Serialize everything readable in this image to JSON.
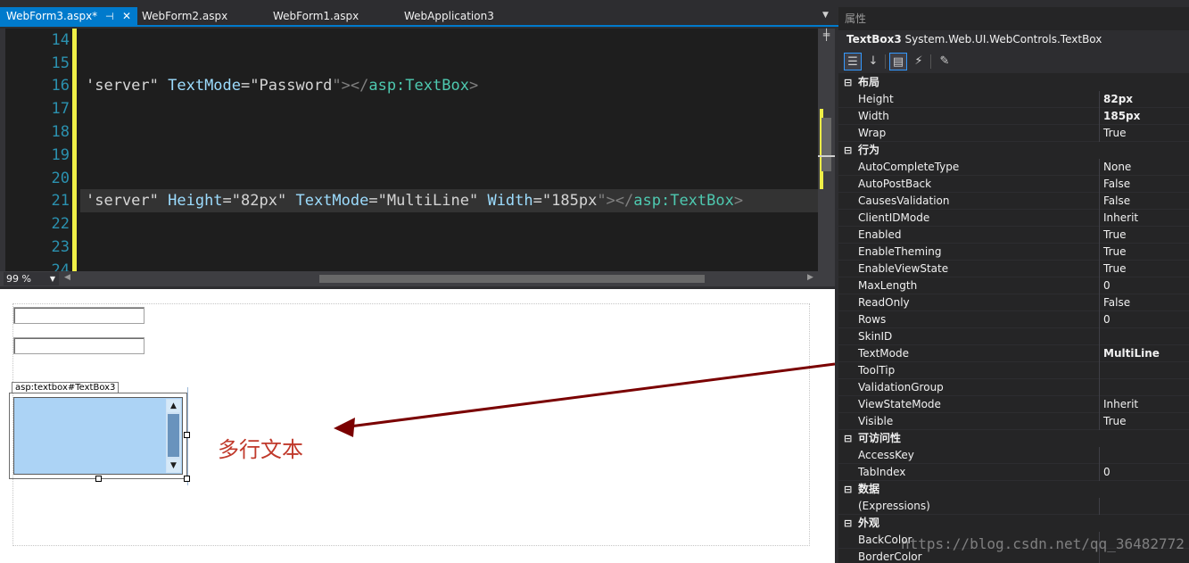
{
  "tabs": [
    {
      "label": "WebForm3.aspx*",
      "active": true
    },
    {
      "label": "WebForm2.aspx",
      "active": false
    },
    {
      "label": "WebForm1.aspx",
      "active": false
    },
    {
      "label": "WebApplication3",
      "active": false
    }
  ],
  "editor": {
    "line_numbers": [
      "14",
      "15",
      "16",
      "17",
      "18",
      "19",
      "20",
      "21",
      "22",
      "23",
      "24"
    ],
    "line16": {
      "a": "'server\" ",
      "b": "TextMode",
      "c": "=\"",
      "d": "Password",
      "e": "\"></",
      "f": "asp:TextBox",
      "g": ">"
    },
    "line21": {
      "a": "'server\" ",
      "b": "Height",
      "c": "=\"",
      "d": "82px",
      "e": "\" ",
      "f": "TextMode",
      "g": "=\"",
      "h": "MultiLine",
      "i": "\" ",
      "j": "Width",
      "k": "=\"",
      "l": "185px",
      "m": "\"></",
      "n": "asp:TextBox",
      "o": ">"
    },
    "zoom": "99 %"
  },
  "design": {
    "selection_tag": "asp:textbox#TextBox3",
    "annotation": "多行文本"
  },
  "properties": {
    "title": "属性",
    "object_name": "TextBox3",
    "object_type": "System.Web.UI.WebControls.TextBox",
    "categories": [
      {
        "name": "布局",
        "rows": [
          {
            "name": "Height",
            "value": "82px",
            "bold": true
          },
          {
            "name": "Width",
            "value": "185px",
            "bold": true
          },
          {
            "name": "Wrap",
            "value": "True"
          }
        ]
      },
      {
        "name": "行为",
        "rows": [
          {
            "name": "AutoCompleteType",
            "value": "None"
          },
          {
            "name": "AutoPostBack",
            "value": "False"
          },
          {
            "name": "CausesValidation",
            "value": "False"
          },
          {
            "name": "ClientIDMode",
            "value": "Inherit"
          },
          {
            "name": "Enabled",
            "value": "True"
          },
          {
            "name": "EnableTheming",
            "value": "True"
          },
          {
            "name": "EnableViewState",
            "value": "True"
          },
          {
            "name": "MaxLength",
            "value": "0"
          },
          {
            "name": "ReadOnly",
            "value": "False"
          },
          {
            "name": "Rows",
            "value": "0"
          },
          {
            "name": "SkinID",
            "value": ""
          },
          {
            "name": "TextMode",
            "value": "MultiLine",
            "bold": true
          },
          {
            "name": "ToolTip",
            "value": ""
          },
          {
            "name": "ValidationGroup",
            "value": ""
          },
          {
            "name": "ViewStateMode",
            "value": "Inherit"
          },
          {
            "name": "Visible",
            "value": "True"
          }
        ]
      },
      {
        "name": "可访问性",
        "rows": [
          {
            "name": "AccessKey",
            "value": ""
          },
          {
            "name": "TabIndex",
            "value": "0"
          }
        ]
      },
      {
        "name": "数据",
        "rows": [
          {
            "name": "(Expressions)",
            "value": ""
          }
        ]
      },
      {
        "name": "外观",
        "rows": [
          {
            "name": "BackColor",
            "value": ""
          },
          {
            "name": "BorderColor",
            "value": ""
          }
        ]
      }
    ]
  },
  "watermark": "https://blog.csdn.net/qq_36482772"
}
